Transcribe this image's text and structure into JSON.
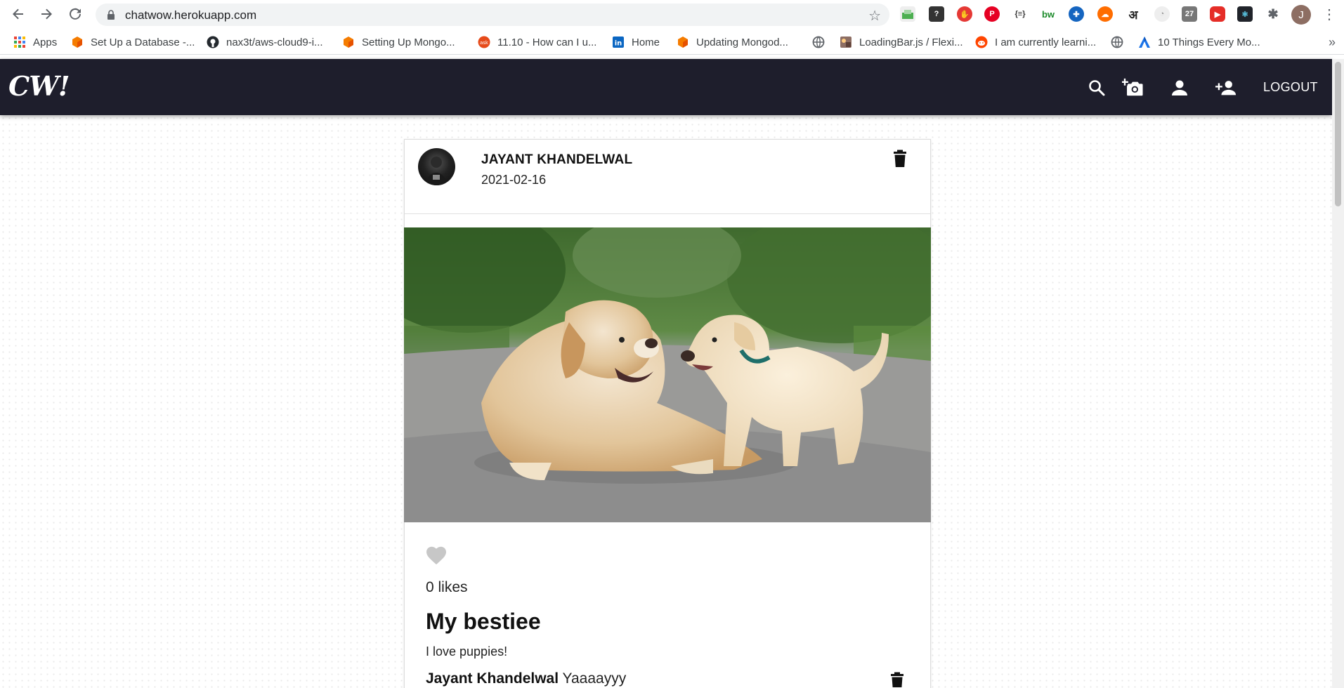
{
  "browser": {
    "url": "chatwow.herokuapp.com",
    "bookmarks": [
      {
        "label": "Apps",
        "icon": "apps-grid-icon"
      },
      {
        "label": "Set Up a Database -...",
        "icon": "cube-orange-icon"
      },
      {
        "label": "nax3t/aws-cloud9-i...",
        "icon": "github-icon"
      },
      {
        "label": "Setting Up Mongo...",
        "icon": "cube-orange-icon"
      },
      {
        "label": "11.10 - How can I u...",
        "icon": "ask-icon"
      },
      {
        "label": "Home",
        "icon": "linkedin-icon"
      },
      {
        "label": "Updating Mongod...",
        "icon": "cube-orange-icon"
      },
      {
        "label": "",
        "icon": "globe-icon"
      },
      {
        "label": "LoadingBar.js / Flexi...",
        "icon": "site-icon"
      },
      {
        "label": "I am currently learni...",
        "icon": "reddit-icon"
      },
      {
        "label": "",
        "icon": "globe-icon"
      },
      {
        "label": "10 Things Every Mo...",
        "icon": "arch-icon"
      }
    ],
    "more": "»",
    "profile_initial": "J"
  },
  "app": {
    "brand": "CW!",
    "logout_label": "LOGOUT",
    "colors": {
      "navbar": "#1e1e2c",
      "text": "#ffffff"
    }
  },
  "post": {
    "author": "JAYANT KHANDELWAL",
    "date": "2021-02-16",
    "likes": "0 likes",
    "title": "My bestiee",
    "caption": "I love puppies!",
    "comment": {
      "author": "Jayant Khandelwal",
      "text": "Yaaaayyy"
    }
  }
}
